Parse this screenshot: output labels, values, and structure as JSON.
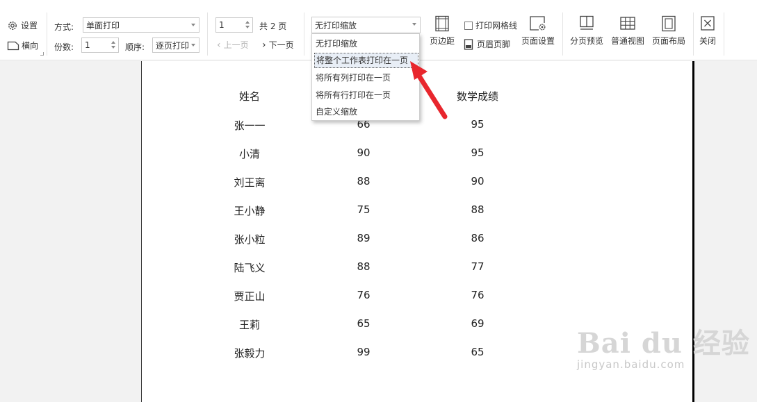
{
  "toolbar": {
    "settings_label": "设置",
    "landscape_label": "横向",
    "mode_label": "方式:",
    "mode_value": "单面打印",
    "copies_label": "份数:",
    "copies_value": "1",
    "order_label": "顺序:",
    "order_value": "逐页打印",
    "page_value": "1",
    "total_pages": "共 2 页",
    "prev_page": "上一页",
    "next_page": "下一页",
    "scale_value": "无打印缩放",
    "print_gridlines": "打印网格线",
    "margins": "页边距",
    "header_footer": "页眉页脚",
    "page_setup": "页面设置",
    "page_break_preview": "分页预览",
    "normal_view": "普通视图",
    "page_layout": "页面布局",
    "close": "关闭"
  },
  "dropdown": {
    "items": [
      "无打印缩放",
      "将整个工作表打印在一页",
      "将所有列打印在一页",
      "将所有行打印在一页",
      "自定义缩放"
    ],
    "highlighted": "将整个工作表打印在一页"
  },
  "sheet": {
    "headers": [
      "姓名",
      "",
      "数学成绩"
    ],
    "rows": [
      [
        "张一一",
        "66",
        "95"
      ],
      [
        "小清",
        "90",
        "95"
      ],
      [
        "刘王离",
        "88",
        "90"
      ],
      [
        "王小静",
        "75",
        "88"
      ],
      [
        "张小粒",
        "89",
        "86"
      ],
      [
        "陆飞义",
        "88",
        "77"
      ],
      [
        "贾正山",
        "76",
        "76"
      ],
      [
        "王莉",
        "65",
        "69"
      ],
      [
        "张毅力",
        "99",
        "65"
      ]
    ]
  },
  "watermark": {
    "big": "Bai du 经验",
    "small": "jingyan.baidu.com"
  },
  "colors": {
    "arrow": "#e8262d",
    "highlight": "#e8eef6"
  }
}
